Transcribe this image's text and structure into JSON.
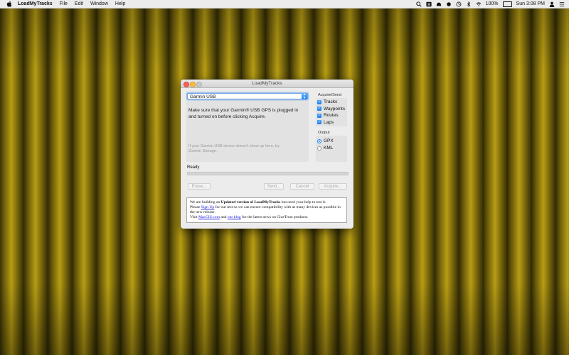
{
  "menubar": {
    "app_name": "LoadMyTracks",
    "items": [
      "File",
      "Edit",
      "Window",
      "Help"
    ],
    "battery_percent": "100%",
    "clock": "Sun 3:08 PM"
  },
  "window": {
    "title": "LoadMyTracks",
    "device_select": {
      "selected": "Garmin USB"
    },
    "message": "Make sure that your Garmin® USB GPS is plugged in and turned on before clicking Acquire.",
    "hint": "If your Garmin USB device doesn't show up here, try Garmin Storage.",
    "acquire_send": {
      "title": "Acquire/Send",
      "items": [
        {
          "label": "Tracks",
          "checked": true
        },
        {
          "label": "Waypoints",
          "checked": true
        },
        {
          "label": "Routes",
          "checked": true
        },
        {
          "label": "Laps",
          "checked": true
        }
      ]
    },
    "output": {
      "title": "Output",
      "options": [
        {
          "label": "GPX",
          "selected": true
        },
        {
          "label": "KML",
          "selected": false
        }
      ]
    },
    "status": "Ready",
    "progress": 0,
    "buttons": {
      "erase": "Erase...",
      "send": "Send...",
      "cancel": "Cancel",
      "acquire": "Acquire..."
    },
    "info": {
      "line1_pre": "We are building an ",
      "line1_bold": "Updated version of LoadMyTracks",
      "line1_post": " but need your help to test it.",
      "line2_pre": "Please ",
      "signup_link": "Sign Up",
      "line2_post": " for our test so we can ensure compatibility with as many devices as possible in the new release.",
      "line3_pre": "Visit ",
      "macgis_link": "MacGIS.com",
      "line3_mid": " and ",
      "blog_link": "our blog",
      "line3_post": " for the latest news on ClueTrust products."
    }
  },
  "icons": [
    "apple-icon",
    "search-icon",
    "control-icon",
    "notification-icon",
    "time-machine-icon",
    "bluetooth-icon",
    "wifi-icon",
    "battery-icon",
    "user-icon",
    "menu-list-icon"
  ],
  "colors": {
    "accent": "#1a7ef2",
    "curtain": "#9a840f"
  }
}
